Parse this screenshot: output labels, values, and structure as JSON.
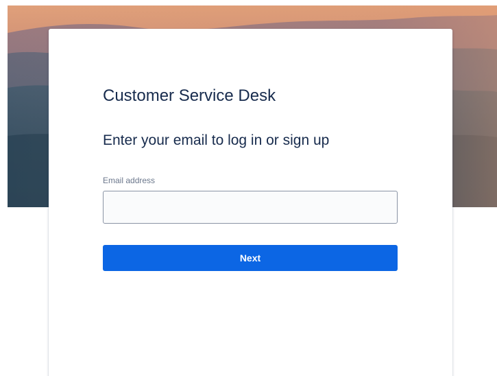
{
  "login": {
    "title": "Customer Service Desk",
    "subtitle": "Enter your email to log in or sign up",
    "email_label": "Email address",
    "email_value": "",
    "email_placeholder": "",
    "next_label": "Next"
  },
  "colors": {
    "primary_button": "#0c66e4",
    "heading_text": "#172b4d",
    "label_text": "#6b778c",
    "input_border": "#8993a4",
    "input_background": "#fafbfc"
  }
}
